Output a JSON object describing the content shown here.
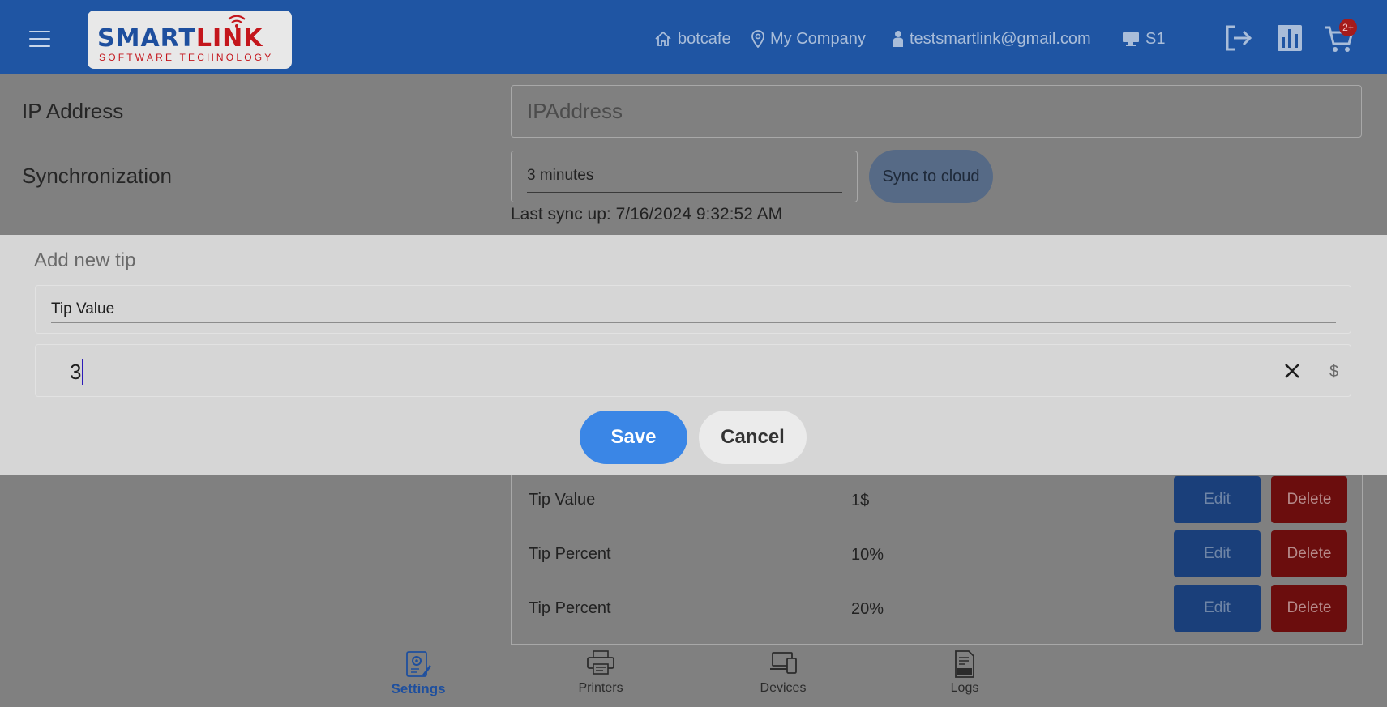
{
  "header": {
    "logo": {
      "main_a": "SMART",
      "main_b": "LINK",
      "sub": "SOFTWARE TECHNOLOGY"
    },
    "store": "botcafe",
    "company": "My Company",
    "user": "testsmartlink@gmail.com",
    "station": "S1",
    "cart_badge": "2+",
    "colors": {
      "bar": "#1f55a3",
      "badge": "#a51b1b"
    }
  },
  "settings": {
    "ip_label": "IP Address",
    "ip_placeholder": "IPAddress",
    "sync_label": "Synchronization",
    "sync_value": "3 minutes",
    "sync_button": "Sync to cloud",
    "last_sync": "Last sync up: 7/16/2024 9:32:52 AM"
  },
  "tips": {
    "edit_label": "Edit",
    "delete_label": "Delete",
    "rows": [
      {
        "name": "Tip Value",
        "value": "1$"
      },
      {
        "name": "Tip Percent",
        "value": "10%"
      },
      {
        "name": "Tip Percent",
        "value": "20%"
      }
    ]
  },
  "modal": {
    "title": "Add new tip",
    "type_value": "Tip Value",
    "amount_value": "3",
    "suffix": "$",
    "save_label": "Save",
    "cancel_label": "Cancel",
    "colors": {
      "save": "#3a86e6"
    }
  },
  "bottom_nav": {
    "active": "Settings",
    "tabs": [
      {
        "label": "Settings",
        "icon": "settings-icon"
      },
      {
        "label": "Printers",
        "icon": "printer-icon"
      },
      {
        "label": "Devices",
        "icon": "devices-icon"
      },
      {
        "label": "Logs",
        "icon": "log-icon"
      }
    ]
  }
}
